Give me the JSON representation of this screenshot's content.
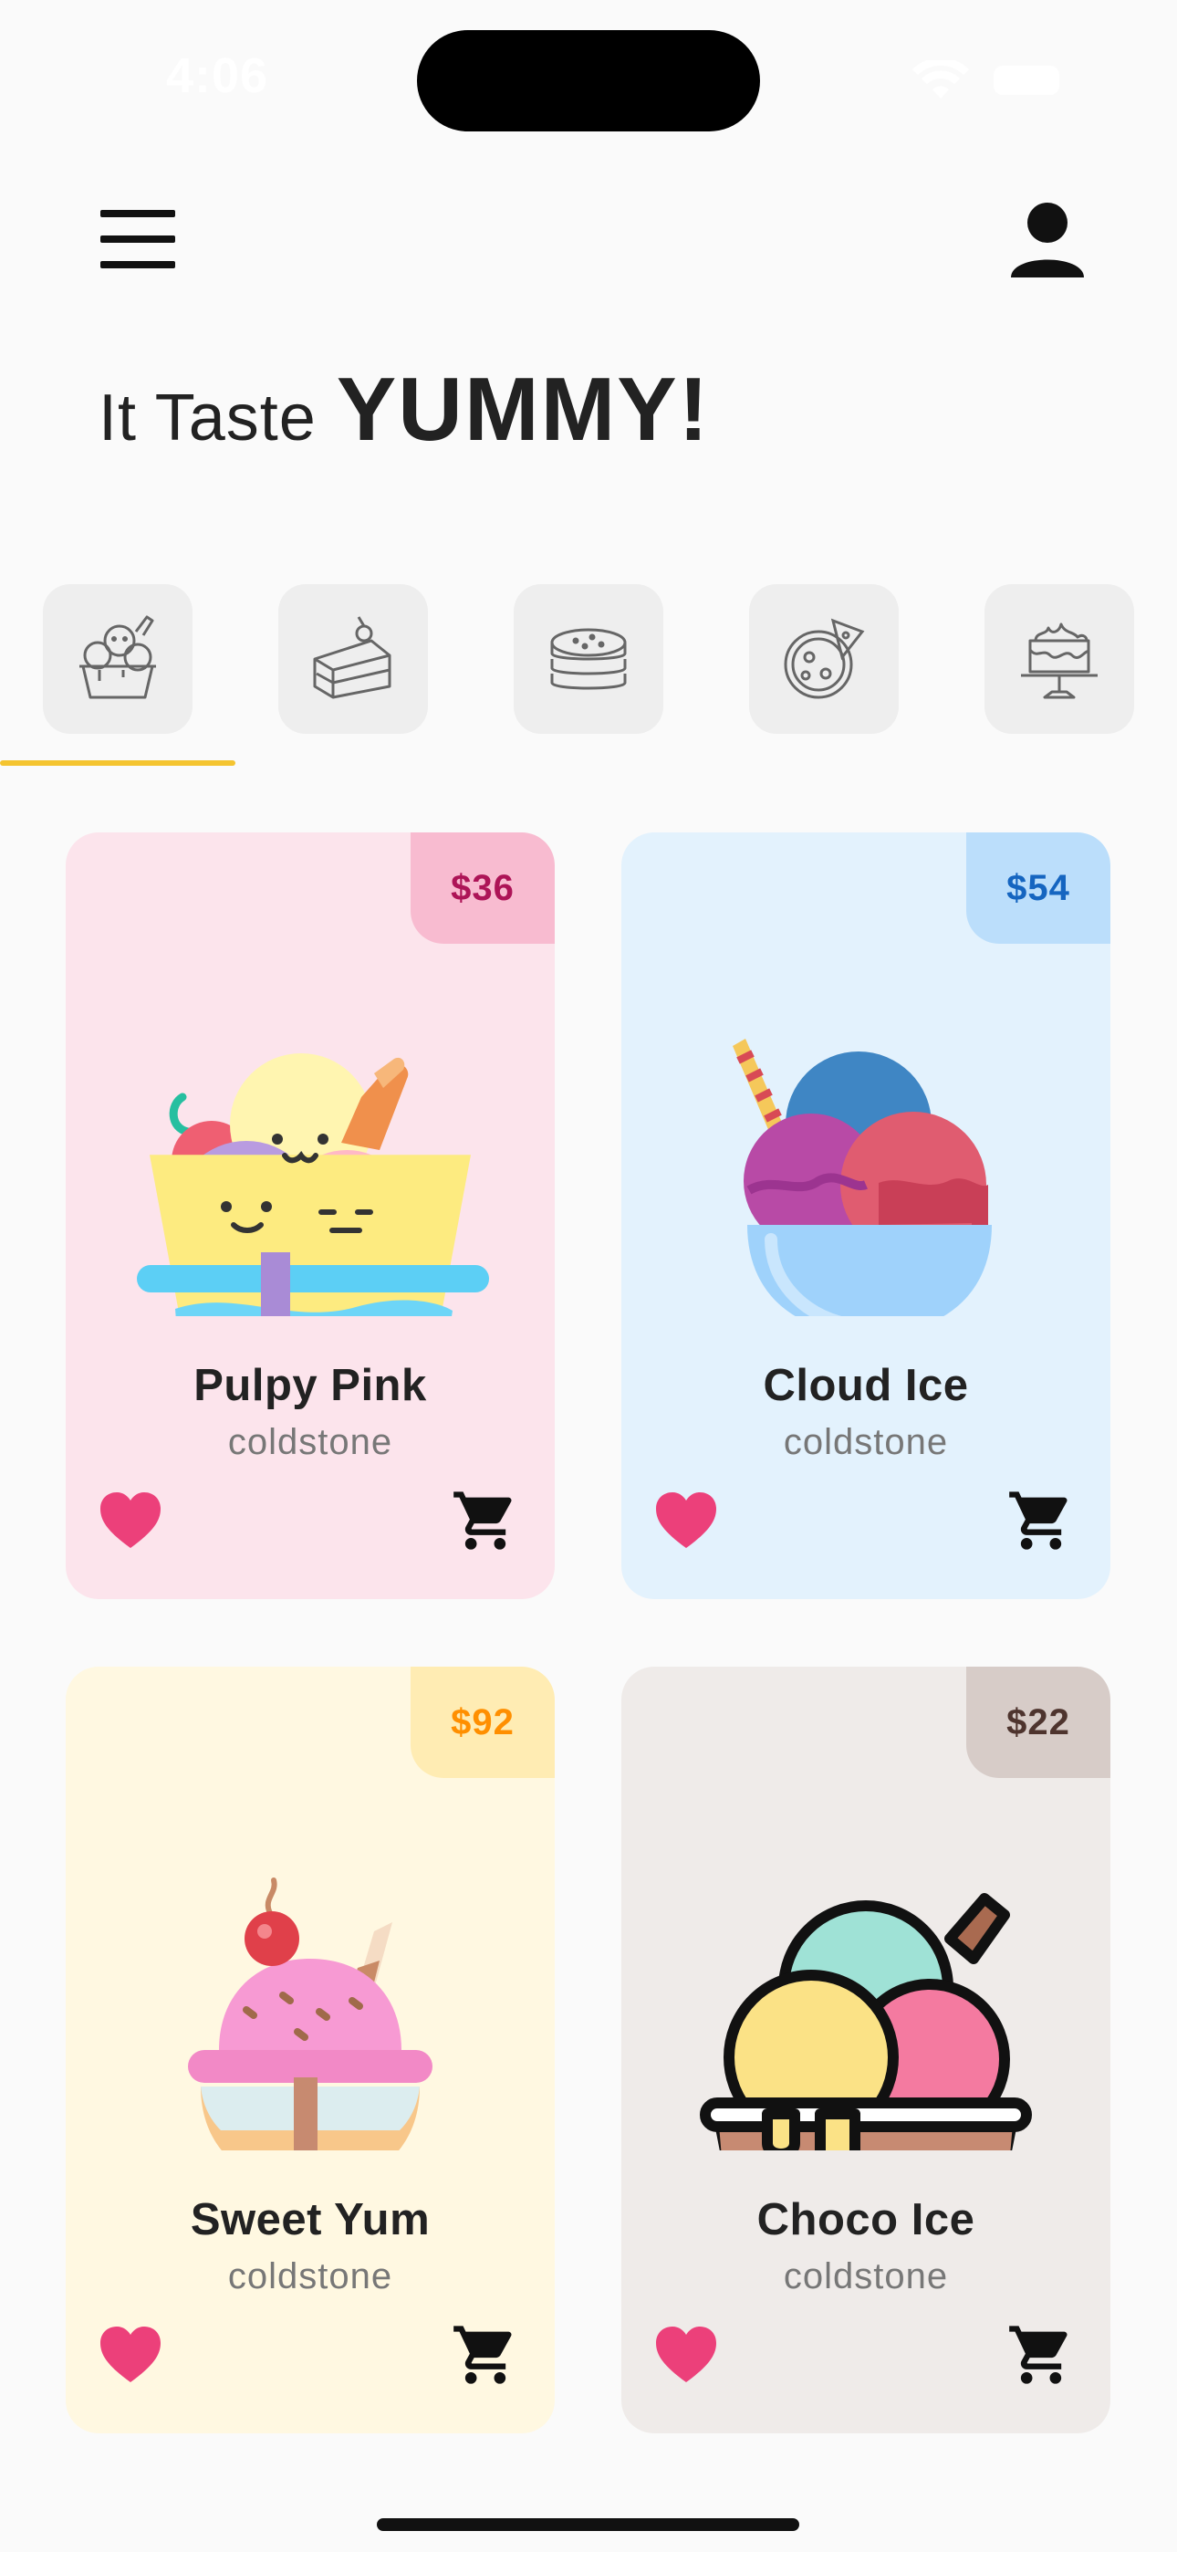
{
  "status_bar": {
    "time": "4:06"
  },
  "header": {
    "headline_light": "It Taste",
    "headline_bold": "YUMMY!"
  },
  "categories": [
    {
      "name": "ice-cream",
      "icon": "ice-cream-cup-icon",
      "selected": true
    },
    {
      "name": "cake-slice",
      "icon": "cake-slice-icon",
      "selected": false
    },
    {
      "name": "pancakes",
      "icon": "pancakes-icon",
      "selected": false
    },
    {
      "name": "pizza",
      "icon": "pizza-icon",
      "selected": false
    },
    {
      "name": "cake",
      "icon": "cake-stand-icon",
      "selected": false
    }
  ],
  "products": [
    {
      "name": "Pulpy Pink",
      "brand": "coldstone",
      "price": "$36",
      "card_color": "#fce4ec",
      "tag_color": "#f8bbd0",
      "price_color": "#ad1457",
      "image": "ice-cream-bowl-faces-icon"
    },
    {
      "name": "Cloud Ice",
      "brand": "coldstone",
      "price": "$54",
      "card_color": "#e3f2fd",
      "tag_color": "#bbdefb",
      "price_color": "#1565c0",
      "image": "ice-cream-goblet-icon"
    },
    {
      "name": "Sweet Yum",
      "brand": "coldstone",
      "price": "$92",
      "card_color": "#fff8e1",
      "tag_color": "#ffecb3",
      "price_color": "#ff8f00",
      "image": "ice-cream-sundae-icon"
    },
    {
      "name": "Choco Ice",
      "brand": "coldstone",
      "price": "$22",
      "card_color": "#efebe9",
      "tag_color": "#d7ccc8",
      "price_color": "#4e342e",
      "image": "ice-cream-basket-icon"
    }
  ],
  "colors": {
    "heart": "#ec407a",
    "accent": "#f4c430"
  }
}
